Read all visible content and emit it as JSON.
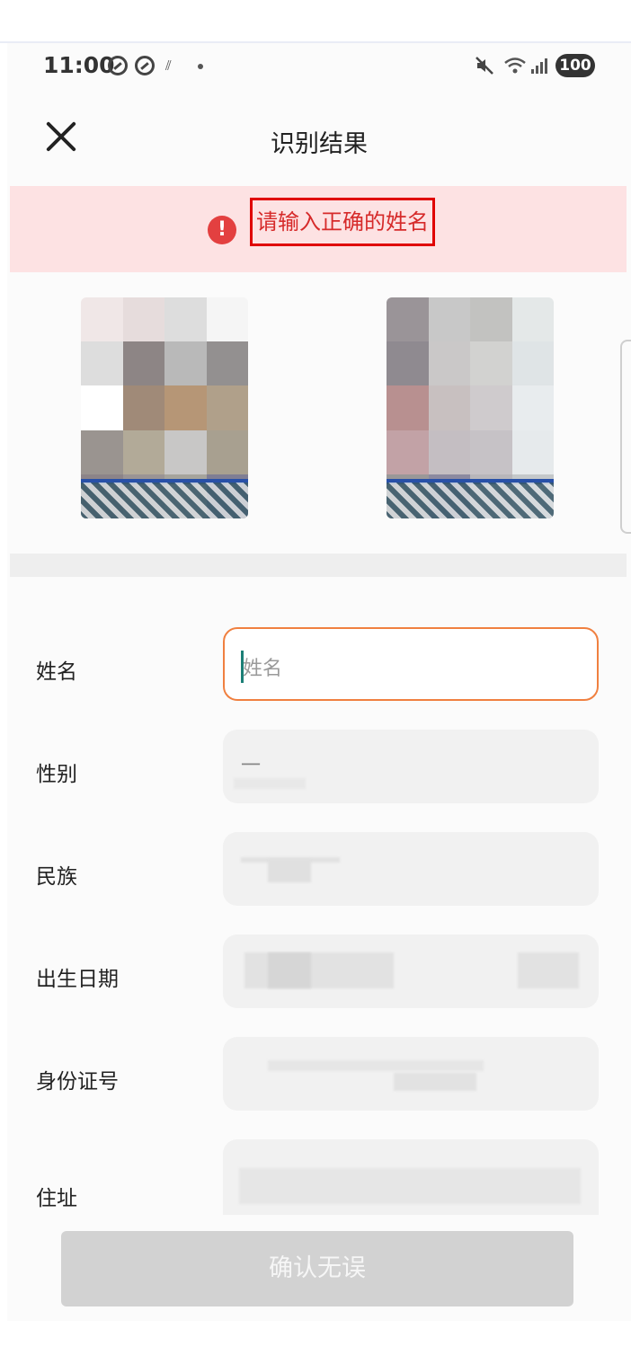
{
  "status_bar": {
    "time": "11:00",
    "battery": "100"
  },
  "header": {
    "title": "识别结果"
  },
  "alert": {
    "message": "请输入正确的姓名"
  },
  "form": {
    "fields": [
      {
        "label": "姓名",
        "value": "",
        "placeholder": "姓名"
      },
      {
        "label": "性别",
        "value": "一"
      },
      {
        "label": "民族",
        "value": ""
      },
      {
        "label": "出生日期",
        "value": ""
      },
      {
        "label": "身份证号",
        "value": ""
      },
      {
        "label": "住址",
        "value": ""
      }
    ]
  },
  "confirm_button": {
    "label": "确认无误"
  },
  "colors": {
    "accent": "#f08040",
    "error": "#d62a2a",
    "alert_bg": "#fde2e3",
    "button_disabled": "#d2d2d2"
  }
}
